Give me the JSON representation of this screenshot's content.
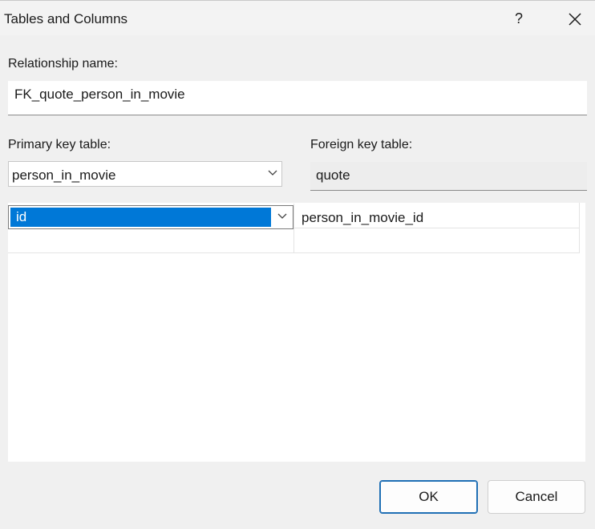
{
  "window": {
    "title": "Tables and Columns",
    "help_glyph": "?",
    "close_icon": "close-icon"
  },
  "relationship": {
    "label": "Relationship name:",
    "value": "FK_quote_person_in_movie"
  },
  "primary_key": {
    "label": "Primary key table:",
    "selected": "person_in_movie",
    "icon": "chevron-down-icon"
  },
  "foreign_key": {
    "label": "Foreign key table:",
    "value": "quote"
  },
  "columns": {
    "rows": [
      {
        "primary": "id",
        "foreign": "person_in_movie_id"
      },
      {
        "primary": "",
        "foreign": ""
      }
    ],
    "selection_color": "#0078d7"
  },
  "buttons": {
    "ok": "OK",
    "cancel": "Cancel"
  }
}
